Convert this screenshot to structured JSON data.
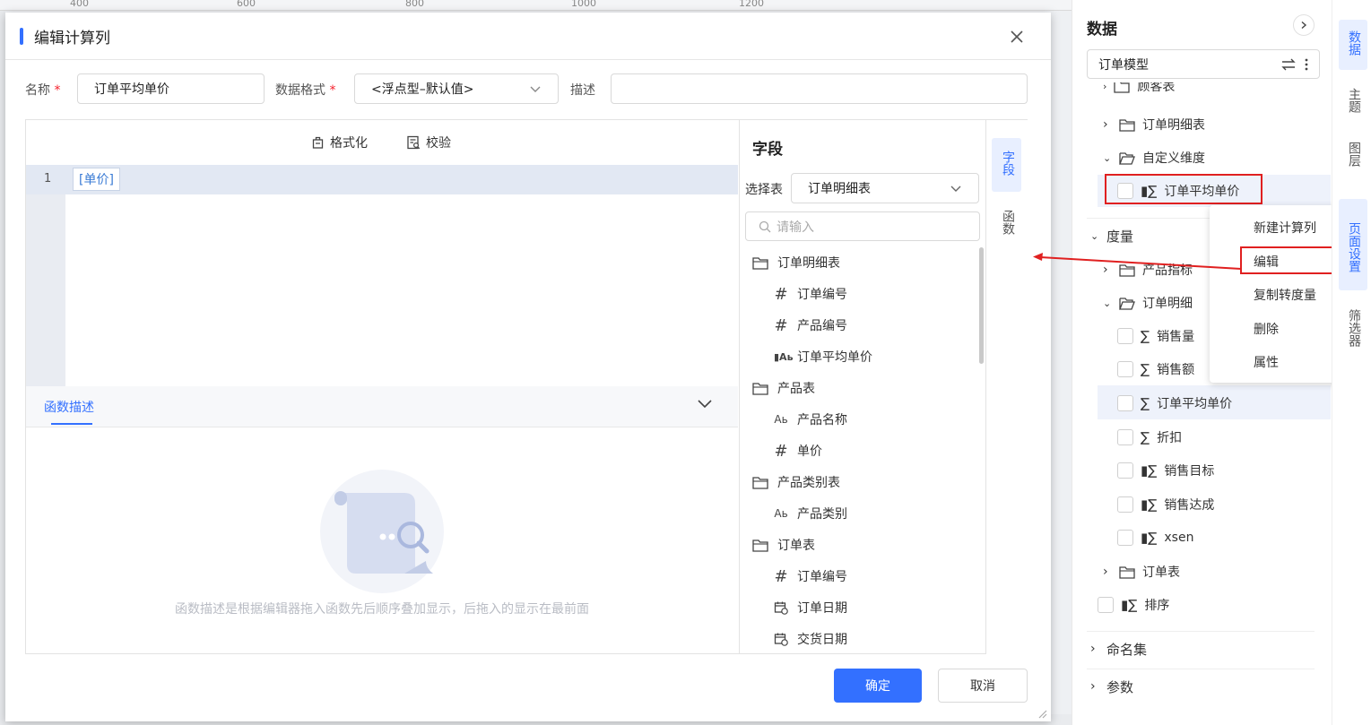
{
  "ruler": {
    "ticks": [
      "400",
      "600",
      "800",
      "1000",
      "1200"
    ]
  },
  "dialog": {
    "title": "编辑计算列",
    "name_label": "名称",
    "name_value": "订单平均单价",
    "format_label": "数据格式",
    "format_value": "<浮点型–默认值>",
    "desc_label": "描述",
    "desc_value": "",
    "required_mark": "*",
    "toolbar": {
      "format_label": "格式化",
      "validate_label": "校验"
    },
    "editor": {
      "line_number": "1",
      "token": "[单价]"
    },
    "func_desc": {
      "title": "函数描述",
      "empty_text": "函数描述是根据编辑器拖入函数先后顺序叠加显示，后拖入的显示在最前面"
    },
    "fields_panel": {
      "title": "字段",
      "select_label": "选择表",
      "select_value": "订单明细表",
      "search_placeholder": "请输入",
      "tree": [
        {
          "type": "folder",
          "label": "订单明细表"
        },
        {
          "type": "number",
          "label": "订单编号"
        },
        {
          "type": "number",
          "label": "产品编号"
        },
        {
          "type": "calc",
          "label": "订单平均单价"
        },
        {
          "type": "folder",
          "label": "产品表"
        },
        {
          "type": "text",
          "label": "产品名称"
        },
        {
          "type": "number",
          "label": "单价"
        },
        {
          "type": "folder",
          "label": "产品类别表"
        },
        {
          "type": "text",
          "label": "产品类别"
        },
        {
          "type": "folder",
          "label": "订单表"
        },
        {
          "type": "number",
          "label": "订单编号"
        },
        {
          "type": "date",
          "label": "订单日期"
        },
        {
          "type": "date",
          "label": "交货日期"
        }
      ]
    },
    "side_tabs": {
      "fields": "字段",
      "functions": "函数"
    },
    "ok_label": "确定",
    "cancel_label": "取消"
  },
  "data_panel": {
    "title": "数据",
    "model": "订单模型",
    "partial_top": "顾客表",
    "detail_table": "订单明细表",
    "custom_dim": "自定义维度",
    "custom_dim_item": "订单平均单价",
    "measures_label": "度量",
    "product_metrics": "产品指标",
    "order_detail": "订单明细",
    "measure_items": [
      "销售量",
      "销售额",
      "订单平均单价",
      "折扣",
      "销售目标",
      "销售达成",
      "xsen"
    ],
    "order_table": "订单表",
    "sort_label": "排序",
    "named_sets": "命名集",
    "params": "参数"
  },
  "context_menu": {
    "items": [
      "新建计算列",
      "编辑",
      "复制转度量",
      "删除",
      "属性"
    ]
  },
  "right_tabs": [
    "数据",
    "主题",
    "图层",
    "页面设置",
    "筛选器"
  ],
  "colors": {
    "accent": "#3370ff",
    "highlight_red": "#e02020",
    "active_tab_bg": "#e8efff"
  }
}
